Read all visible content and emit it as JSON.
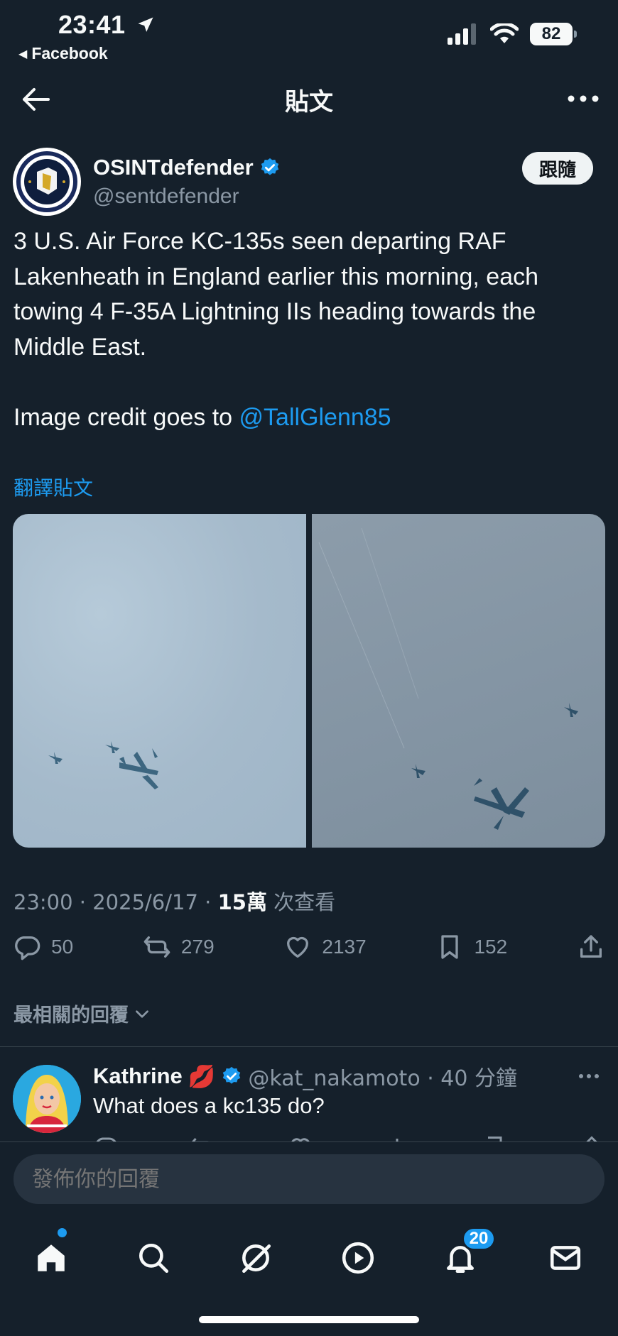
{
  "status_bar": {
    "time": "23:41",
    "back_app": "Facebook",
    "battery": "82"
  },
  "header": {
    "title": "貼文"
  },
  "post": {
    "author_name": "OSINTdefender",
    "author_handle": "@sentdefender",
    "follow_label": "跟隨",
    "text": "3 U.S. Air Force KC-135s seen departing RAF Lakenheath in England earlier this morning, each towing 4 F-35A Lightning IIs heading towards the Middle East.",
    "credit_prefix": "Image credit goes to ",
    "credit_mention": "@TallGlenn85",
    "translate_label": "翻譯貼文",
    "time": "23:00",
    "date": "2025/6/17",
    "views_count": "15萬",
    "views_label": "次查看",
    "replies": "50",
    "reposts": "279",
    "likes": "2137",
    "bookmarks": "152"
  },
  "replies_section": {
    "sort_label": "最相關的回覆"
  },
  "reply": {
    "name": "Kathrine",
    "emoji": "💋",
    "handle": "@kat_nakamoto",
    "time_ago": "40 分鐘",
    "text": "What does a kc135 do?"
  },
  "compose": {
    "placeholder": "發佈你的回覆"
  },
  "tabbar": {
    "notifications_badge": "20"
  },
  "colors": {
    "background": "#15202b",
    "accent": "#1d9bf0",
    "muted_text": "#8b98a5",
    "verified_badge": "#1d9bf0"
  },
  "icons": [
    "back-arrow-icon",
    "location-arrow-icon",
    "signal-icon",
    "wifi-icon",
    "more-icon",
    "verified-icon",
    "reply-icon",
    "repost-icon",
    "like-icon",
    "bookmark-icon",
    "share-icon",
    "chevron-down-icon",
    "home-icon",
    "search-icon",
    "grok-icon",
    "video-icon",
    "notifications-icon",
    "messages-icon"
  ]
}
